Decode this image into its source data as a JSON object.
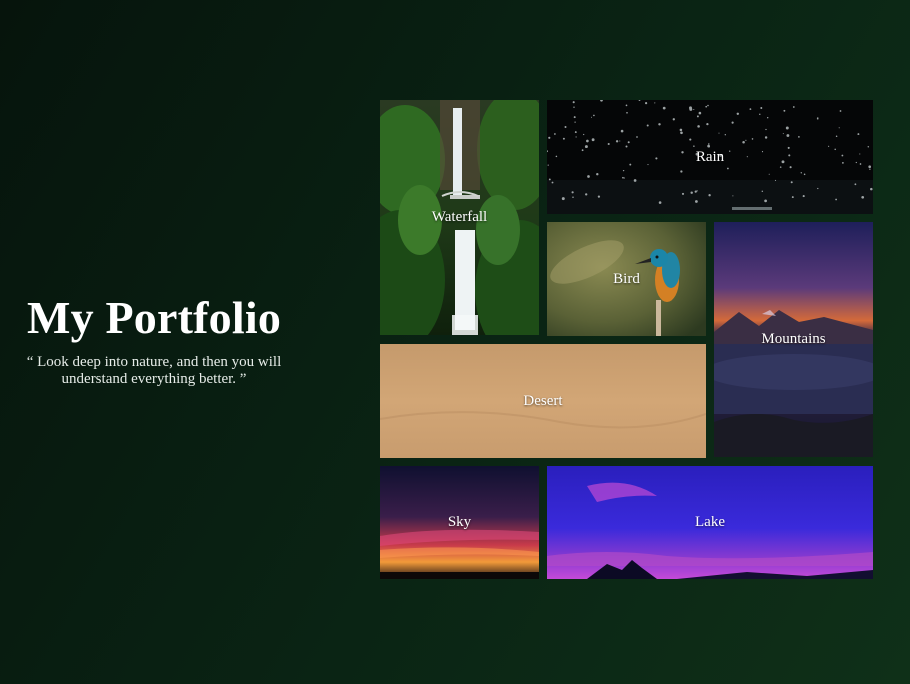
{
  "page": {
    "title": "My Portfolio",
    "quote": "“ Look deep into nature, and then you will understand everything better. ”"
  },
  "gallery": {
    "tiles": [
      {
        "id": "waterfall",
        "label": "Waterfall"
      },
      {
        "id": "rain",
        "label": "Rain"
      },
      {
        "id": "bird",
        "label": "Bird"
      },
      {
        "id": "mountains",
        "label": "Mountains"
      },
      {
        "id": "desert",
        "label": "Desert"
      },
      {
        "id": "sky",
        "label": "Sky"
      },
      {
        "id": "lake",
        "label": "Lake"
      }
    ]
  },
  "colors": {
    "background_dark": "#06140c",
    "background_light": "#0f3018",
    "text": "#ffffff"
  }
}
